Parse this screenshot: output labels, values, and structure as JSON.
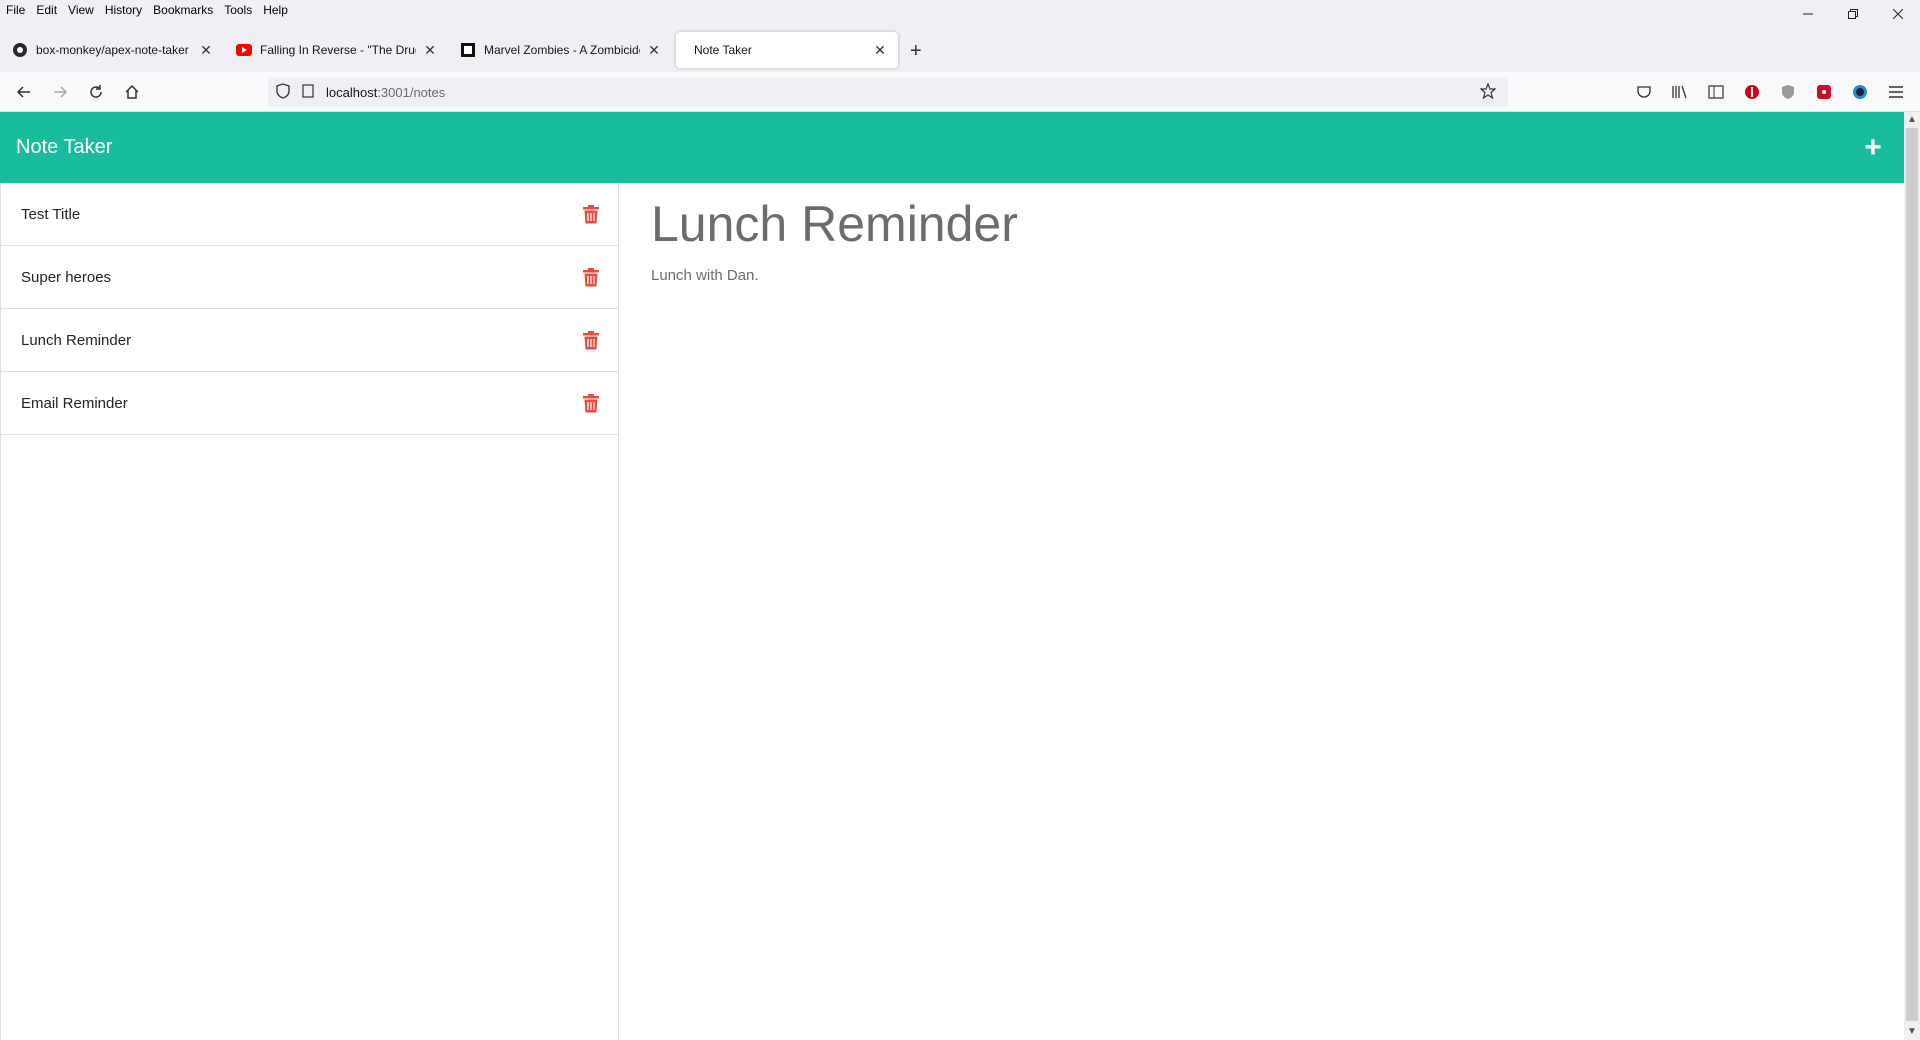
{
  "menubar": {
    "items": [
      "File",
      "Edit",
      "View",
      "History",
      "Bookmarks",
      "Tools",
      "Help"
    ]
  },
  "tabs": [
    {
      "label": "box-monkey/apex-note-taker",
      "icon": "github-icon"
    },
    {
      "label": "Falling In Reverse - \"The Drug In Me",
      "icon": "youtube-icon"
    },
    {
      "label": "Marvel Zombies - A Zombicide",
      "icon": "kickstarter-icon"
    },
    {
      "label": "Note Taker",
      "icon": "",
      "active": true
    }
  ],
  "url": {
    "host": "localhost",
    "path": ":3001/notes"
  },
  "app": {
    "title": "Note Taker",
    "add_label": "+"
  },
  "notes": [
    {
      "title": "Test Title"
    },
    {
      "title": "Super heroes"
    },
    {
      "title": "Lunch Reminder"
    },
    {
      "title": "Email Reminder"
    }
  ],
  "active_note": {
    "title": "Lunch Reminder",
    "text": "Lunch with Dan."
  },
  "colors": {
    "header": "#19bc9c",
    "trash": "#e74c3c",
    "note_text": "#6c6c6c"
  }
}
